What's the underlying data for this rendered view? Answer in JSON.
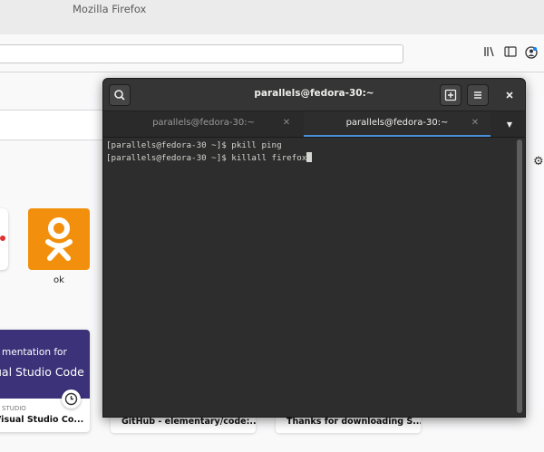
{
  "firefox": {
    "window_title": "Mozilla Firefox",
    "top_site_label": "ok",
    "card1": {
      "line1": "mentation for",
      "line2": "ual Studio Code",
      "source": "STUDIO",
      "title": "Visual Studio Co..."
    },
    "card2_title": "GitHub - elementary/code:...",
    "card3_title": "Thanks for downloading S...",
    "colors": {
      "ok_tile": "#f2900d",
      "card_banner": "#3b3279"
    }
  },
  "terminal": {
    "title": "parallels@fedora-30:~",
    "tabs": [
      {
        "label": "parallels@fedora-30:~",
        "active": false
      },
      {
        "label": "parallels@fedora-30:~",
        "active": true
      }
    ],
    "lines": [
      "[parallels@fedora-30 ~]$ pkill ping",
      "[parallels@fedora-30 ~]$ killall firefox"
    ],
    "colors": {
      "accent": "#4a90d9",
      "background": "#2d2d2d"
    }
  }
}
